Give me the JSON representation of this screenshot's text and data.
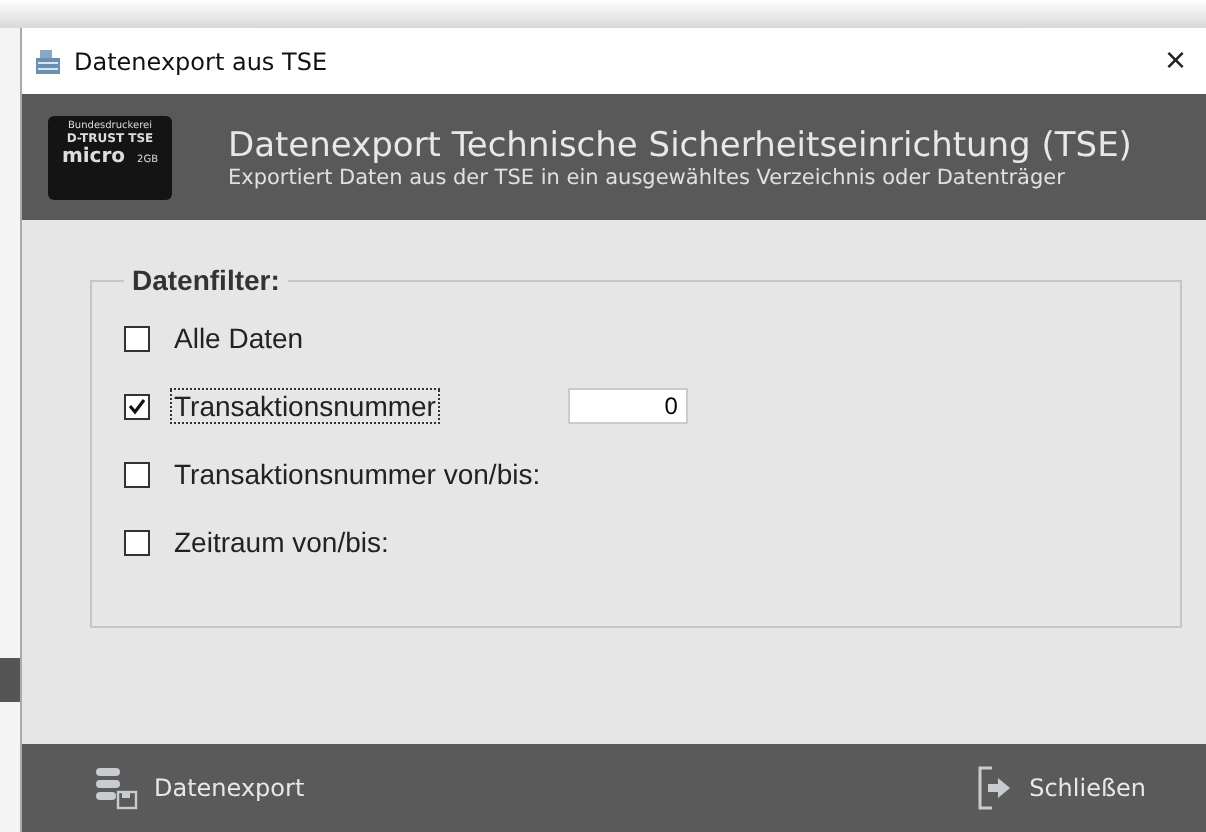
{
  "window": {
    "title": "Datenexport aus TSE",
    "close": "×"
  },
  "header": {
    "title": "Datenexport Technische Sicherheitseinrichtung (TSE)",
    "subtitle": "Exportiert Daten aus der TSE in ein ausgewähltes Verzeichnis oder Datenträger",
    "logo": {
      "line_1": "Bundesdruckerei",
      "line_2": "D-TRUST TSE",
      "line_3": "micro",
      "line_4": "2GB"
    }
  },
  "filter": {
    "legend": "Datenfilter:",
    "options": [
      {
        "label": "Alle Daten",
        "checked": false,
        "focused": false
      },
      {
        "label": "Transaktionsnummer",
        "checked": true,
        "focused": true,
        "value": "0"
      },
      {
        "label": "Transaktionsnummer von/bis:",
        "checked": false,
        "focused": false
      },
      {
        "label": "Zeitraum von/bis:",
        "checked": false,
        "focused": false
      }
    ]
  },
  "footer": {
    "export_button": "Datenexport",
    "close_button": "Schließen"
  }
}
